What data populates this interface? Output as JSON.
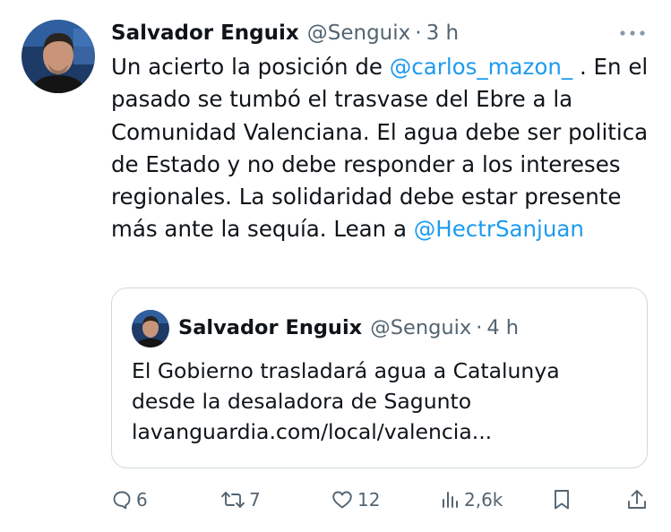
{
  "tweet": {
    "author_name": "Salvador Enguix",
    "author_handle": "@Senguix",
    "separator": "·",
    "time": "3 h",
    "text_before": "Un acierto la posición de ",
    "mention1": "@carlos_mazon_",
    "text_middle": " . En el pasado se tumbó el trasvase del Ebre a la Comunidad Valenciana. El agua debe ser politica de Estado y no debe responder a los intereses regionales. La solidaridad debe estar presente más ante la sequía. Lean a ",
    "mention2": "@HectrSanjuan"
  },
  "quote": {
    "author_name": "Salvador Enguix",
    "author_handle": "@Senguix",
    "separator": "·",
    "time": "4 h",
    "lines": [
      "El Gobierno trasladará agua a Catalunya",
      "desde la desaladora de Sagunto",
      "lavanguardia.com/local/valencia..."
    ]
  },
  "actions": {
    "replies": "6",
    "retweets": "7",
    "likes": "12",
    "views": "2,6k"
  },
  "icons": {
    "more": "more-dots-icon",
    "reply": "reply-bubble-icon",
    "retweet": "retweet-icon",
    "like": "heart-icon",
    "views": "views-bars-icon",
    "bookmark": "bookmark-icon",
    "share": "share-icon"
  },
  "colors": {
    "text": "#0f1419",
    "secondary": "#536471",
    "link": "#1d9bf0",
    "border": "#cfd9de",
    "background": "#ffffff"
  }
}
